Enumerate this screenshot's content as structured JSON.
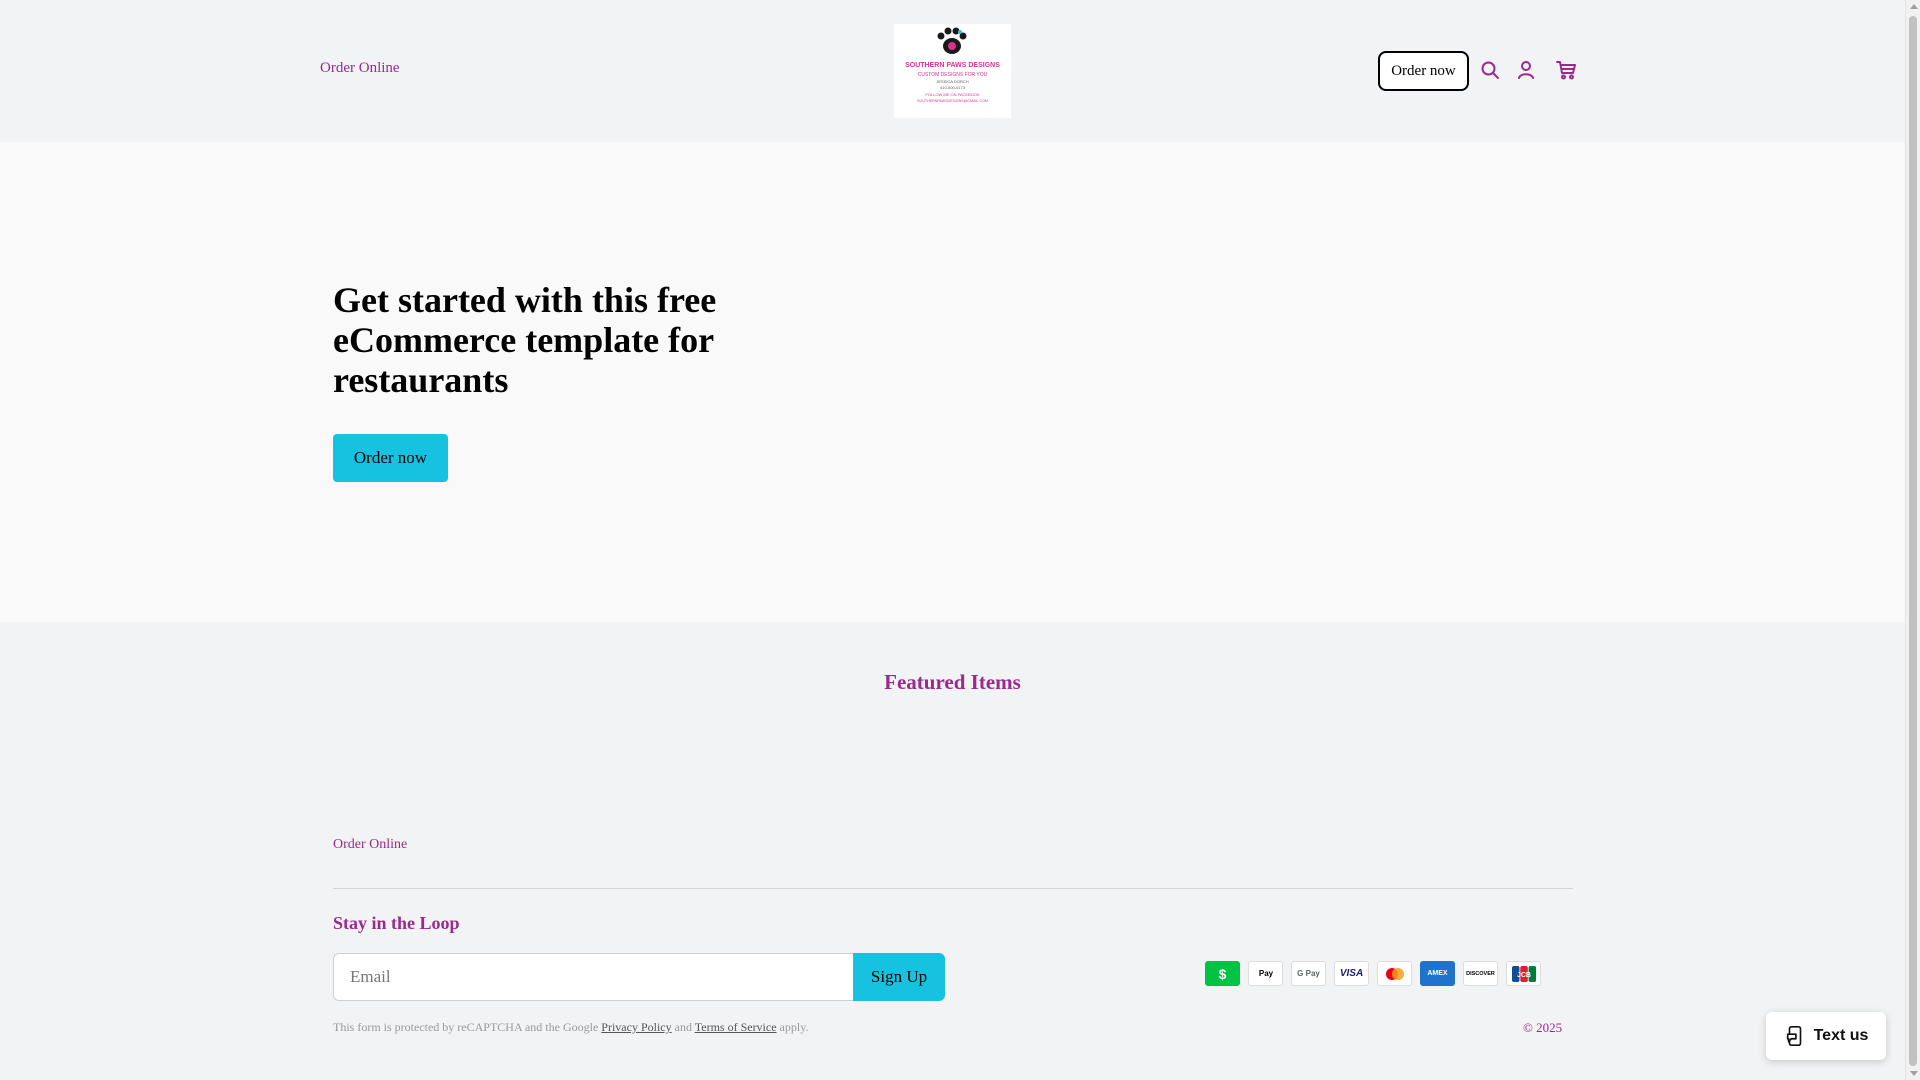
{
  "header": {
    "nav_link": "Order Online",
    "logo": {
      "brand": "SOUTHERN PAWS DESIGNS",
      "line1": "CUSTOM DESIGNS FOR YOU",
      "line2": "JESSICA DORCH",
      "line3": "410-000-0173",
      "line4": "FOLLOW ME ON FACEBOOK",
      "line5": "SOUTHERNPAWSDESIGNS@GMAIL.COM"
    },
    "order_button": "Order now",
    "icons": [
      "search-icon",
      "account-icon",
      "cart-icon"
    ]
  },
  "hero": {
    "title": "Get started with this free eCommerce template for restaurants",
    "button": "Order now"
  },
  "featured": {
    "title": "Featured Items"
  },
  "footer": {
    "link": "Order Online",
    "newsletter_title": "Stay in the Loop",
    "email_placeholder": "Email",
    "signup_button": "Sign Up",
    "recaptcha_prefix": "This form is protected by reCAPTCHA and the Google",
    "privacy_link": "Privacy Policy",
    "and_text": "and",
    "terms_link": "Terms of Service",
    "apply_text": "apply.",
    "copyright": "© 2025",
    "payments": [
      {
        "name": "cash-app-icon",
        "label": "$"
      },
      {
        "name": "apple-pay-icon",
        "label": "Pay"
      },
      {
        "name": "google-pay-icon",
        "label": "G Pay"
      },
      {
        "name": "visa-icon",
        "label": "VISA"
      },
      {
        "name": "mastercard-icon",
        "label": ""
      },
      {
        "name": "amex-icon",
        "label": "AMEX"
      },
      {
        "name": "discover-icon",
        "label": "DISCOVER"
      },
      {
        "name": "jcb-icon",
        "label": "JCB"
      }
    ]
  },
  "widget": {
    "text_us": "Text us"
  },
  "colors": {
    "accent": "#9b2a8e",
    "button": "#17c1e0",
    "background": "#f1f3f4",
    "hero_background": "#f9f9f9"
  }
}
